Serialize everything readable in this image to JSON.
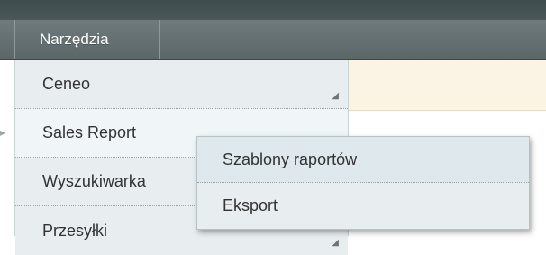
{
  "nav": {
    "tools_label": "Narzędzia"
  },
  "menu": {
    "items": [
      {
        "label": "Ceneo"
      },
      {
        "label": "Sales Report"
      },
      {
        "label": "Wyszukiwarka"
      },
      {
        "label": "Przesyłki"
      }
    ]
  },
  "submenu": {
    "items": [
      {
        "label": "Szablony raportów"
      },
      {
        "label": "Eksport"
      }
    ]
  },
  "colors": {
    "navbar": "#6f7b7c",
    "menu_bg": "#e8eef0",
    "page_band": "#fbf3e3"
  }
}
